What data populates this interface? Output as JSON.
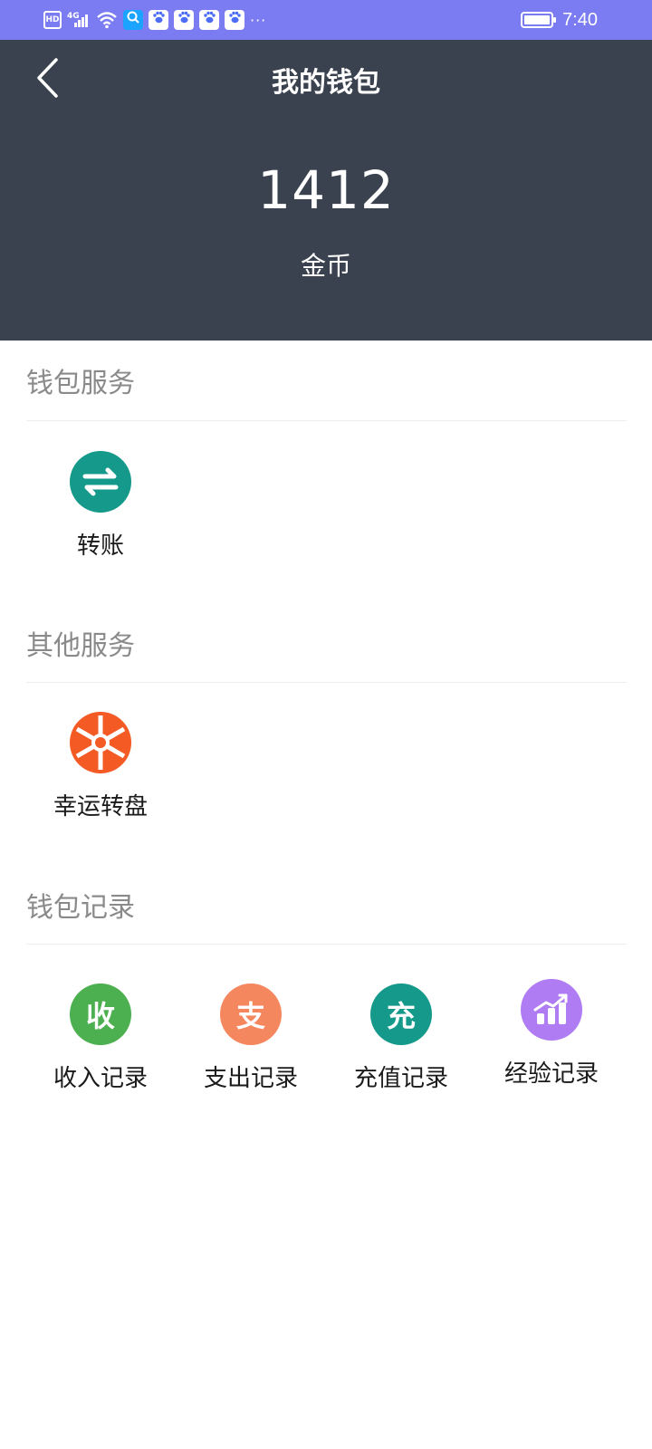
{
  "status_bar": {
    "hd": "HD",
    "network": "4G",
    "time": "7:40",
    "more": "···"
  },
  "header": {
    "title": "我的钱包",
    "balance": "1412",
    "balance_unit": "金币"
  },
  "sections": [
    {
      "title": "钱包服务",
      "items": [
        {
          "label": "转账",
          "icon": "transfer-arrows-icon",
          "color": "#14998a"
        }
      ]
    },
    {
      "title": "其他服务",
      "items": [
        {
          "label": "幸运转盘",
          "icon": "lucky-wheel-icon",
          "color": "#f35a24"
        }
      ]
    },
    {
      "title": "钱包记录",
      "items": [
        {
          "label": "收入记录",
          "icon_text": "收",
          "color": "#4caf50"
        },
        {
          "label": "支出记录",
          "icon_text": "支",
          "color": "#f5875f"
        },
        {
          "label": "充值记录",
          "icon_text": "充",
          "color": "#14998a"
        },
        {
          "label": "经验记录",
          "icon": "bar-chart-icon",
          "color": "#b07cf3"
        }
      ]
    }
  ],
  "colors": {
    "status_bar": "#7b7cf1",
    "header": "#3b424f",
    "section_title": "#8a8a8a"
  }
}
